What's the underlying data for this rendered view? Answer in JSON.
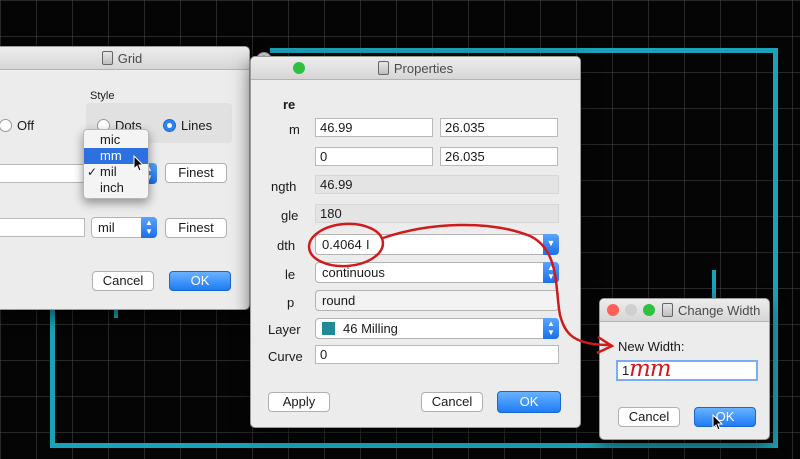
{
  "grid_dialog": {
    "title": "Grid",
    "style_label": "Style",
    "off_label": "Off",
    "dots_label": "Dots",
    "lines_label": "Lines",
    "menu_items": [
      "mic",
      "mm",
      "mil",
      "inch"
    ],
    "selected_menu_item": "mm",
    "checked_menu_item": "mil",
    "finest_label": "Finest",
    "unit_value": "mil",
    "cancel_label": "Cancel",
    "ok_label": "OK"
  },
  "properties_dialog": {
    "title": "Properties",
    "rows": {
      "header": "re",
      "start_label": "m",
      "start_x": "46.99",
      "start_y": "26.035",
      "end_x": "0",
      "end_y": "26.035",
      "length_label": "ngth",
      "length_value": "46.99",
      "angle_label": "gle",
      "angle_value": "180",
      "width_label": "dth",
      "width_value": "0.4064",
      "style_label": "le",
      "style_value": "continuous",
      "cap_label": "p",
      "cap_value": "round",
      "layer_label": "Layer",
      "layer_value": "46 Milling",
      "curve_label": "Curve",
      "curve_value": "0"
    },
    "apply_label": "Apply",
    "cancel_label": "Cancel",
    "ok_label": "OK"
  },
  "change_width_dialog": {
    "title": "Change Width",
    "new_width_label": "New Width:",
    "new_width_value": "1",
    "annotation": "mm",
    "cancel_label": "Cancel",
    "ok_label": "OK"
  },
  "colors": {
    "trace": "#1aa3b8",
    "accent": "#1e7cf5",
    "annotation_ink": "#d11b1b",
    "layer_swatch": "#1f8a9a"
  }
}
